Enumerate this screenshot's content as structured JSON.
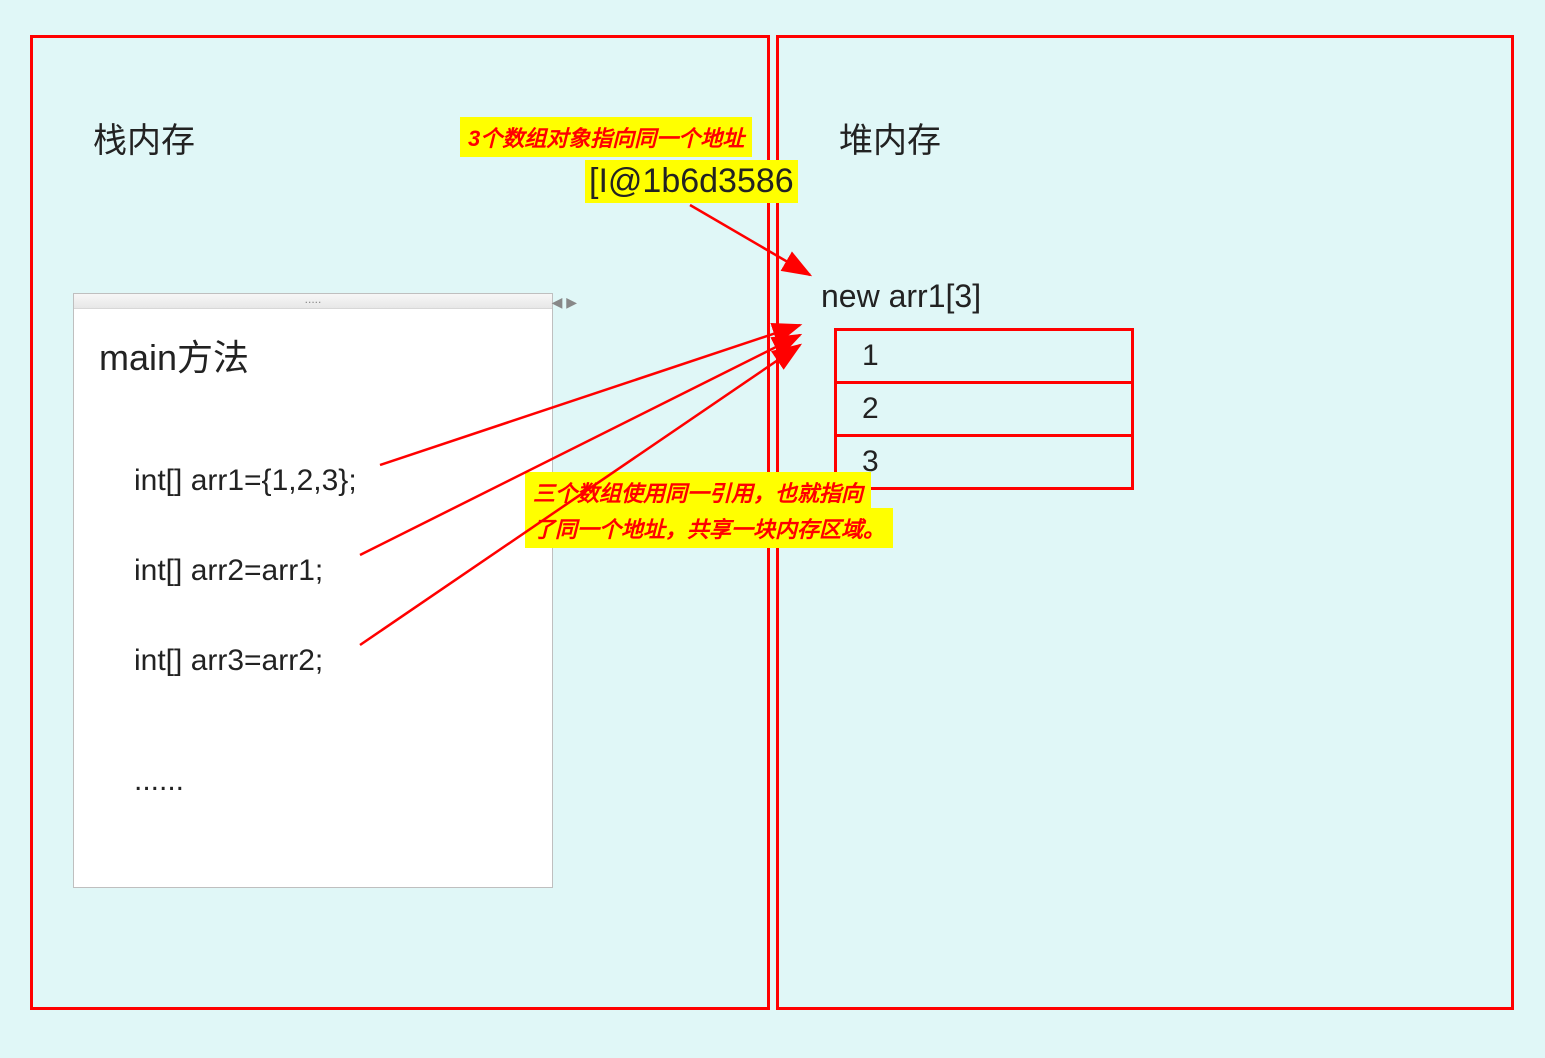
{
  "stack": {
    "title": "栈内存",
    "main_label": "main方法",
    "titlebar_dots": ".....",
    "scroll_hint": "◀ ▶",
    "code": {
      "line1": "int[] arr1={1,2,3};",
      "line2": "int[] arr2=arr1;",
      "line3": "int[] arr3=arr2;",
      "line4": "......"
    }
  },
  "heap": {
    "title": "堆内存",
    "new_label": "new arr1[3]",
    "array_values": {
      "v0": "1",
      "v1": "2",
      "v2": "3"
    }
  },
  "address": "[I@1b6d3586",
  "annotations": {
    "top": "3个数组对象指向同一个地址",
    "bottom_line1": "三个数组使用同一引用，也就指向",
    "bottom_line2": "了同一个地址，共享一块内存区域。"
  }
}
